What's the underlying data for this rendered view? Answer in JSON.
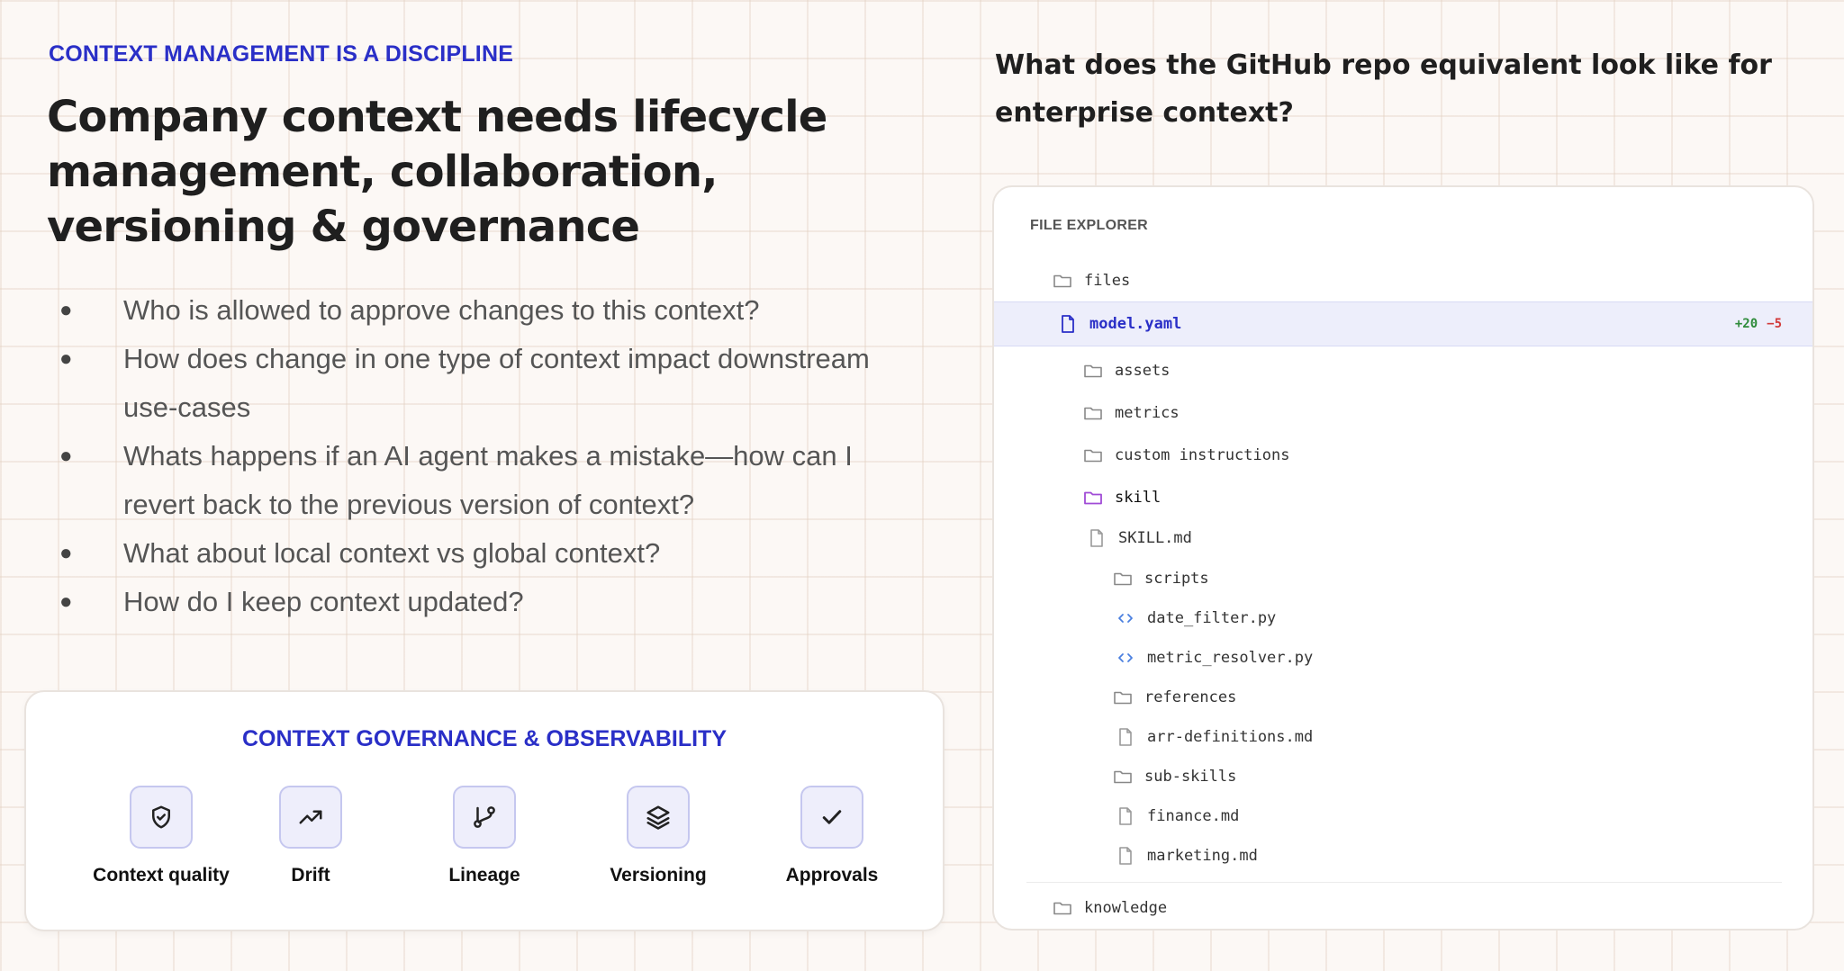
{
  "left": {
    "eyebrow": "CONTEXT MANAGEMENT IS A DISCIPLINE",
    "headline": "Company context needs lifecycle management, collaboration, versioning & governance",
    "bullets": [
      "Who is allowed to approve changes to this context?",
      "How does change in one type of context impact downstream use-cases",
      "Whats happens if an AI agent makes a mistake—how can I revert back to the previous version of context?",
      "What about local context vs global context?",
      "How do I keep context updated?"
    ],
    "governance": {
      "title": "CONTEXT GOVERNANCE & OBSERVABILITY",
      "items": [
        {
          "label": "Context quality",
          "icon": "shield-check-icon"
        },
        {
          "label": "Drift",
          "icon": "trending-up-icon"
        },
        {
          "label": "Lineage",
          "icon": "git-branch-icon"
        },
        {
          "label": "Versioning",
          "icon": "layers-icon"
        },
        {
          "label": "Approvals",
          "icon": "check-icon"
        }
      ]
    }
  },
  "right": {
    "question": "What does the GitHub repo equivalent look like for enterprise context?",
    "explorer": {
      "header": "FILE EXPLORER",
      "rows": [
        {
          "name": "files",
          "type": "folder",
          "icon": "folder-icon"
        },
        {
          "name": "model.yaml",
          "type": "file",
          "icon": "file-icon",
          "selected": true,
          "additions": "+20",
          "deletions": "−5"
        },
        {
          "name": "assets",
          "type": "folder",
          "icon": "folder-icon"
        },
        {
          "name": "metrics",
          "type": "folder",
          "icon": "folder-icon"
        },
        {
          "name": "custom instructions",
          "type": "folder",
          "icon": "folder-icon"
        },
        {
          "name": "skill",
          "type": "folder",
          "icon": "folder-icon",
          "accent": "#a04bd6"
        },
        {
          "name": "SKILL.md",
          "type": "file",
          "icon": "file-icon"
        },
        {
          "name": "scripts",
          "type": "folder",
          "icon": "folder-icon"
        },
        {
          "name": "date_filter.py",
          "type": "code",
          "icon": "code-icon"
        },
        {
          "name": "metric_resolver.py",
          "type": "code",
          "icon": "code-icon"
        },
        {
          "name": "references",
          "type": "folder",
          "icon": "folder-icon"
        },
        {
          "name": "arr-definitions.md",
          "type": "file",
          "icon": "file-icon"
        },
        {
          "name": "sub-skills",
          "type": "folder",
          "icon": "folder-icon"
        },
        {
          "name": "finance.md",
          "type": "file",
          "icon": "file-icon"
        },
        {
          "name": "marketing.md",
          "type": "file",
          "icon": "file-icon"
        },
        {
          "name": "knowledge",
          "type": "folder",
          "icon": "folder-icon"
        }
      ]
    }
  },
  "colors": {
    "accent": "#2a2fc7",
    "add": "#2e8b3a",
    "del": "#d23a3a",
    "skill": "#a04bd6",
    "code": "#4a7fe0"
  }
}
